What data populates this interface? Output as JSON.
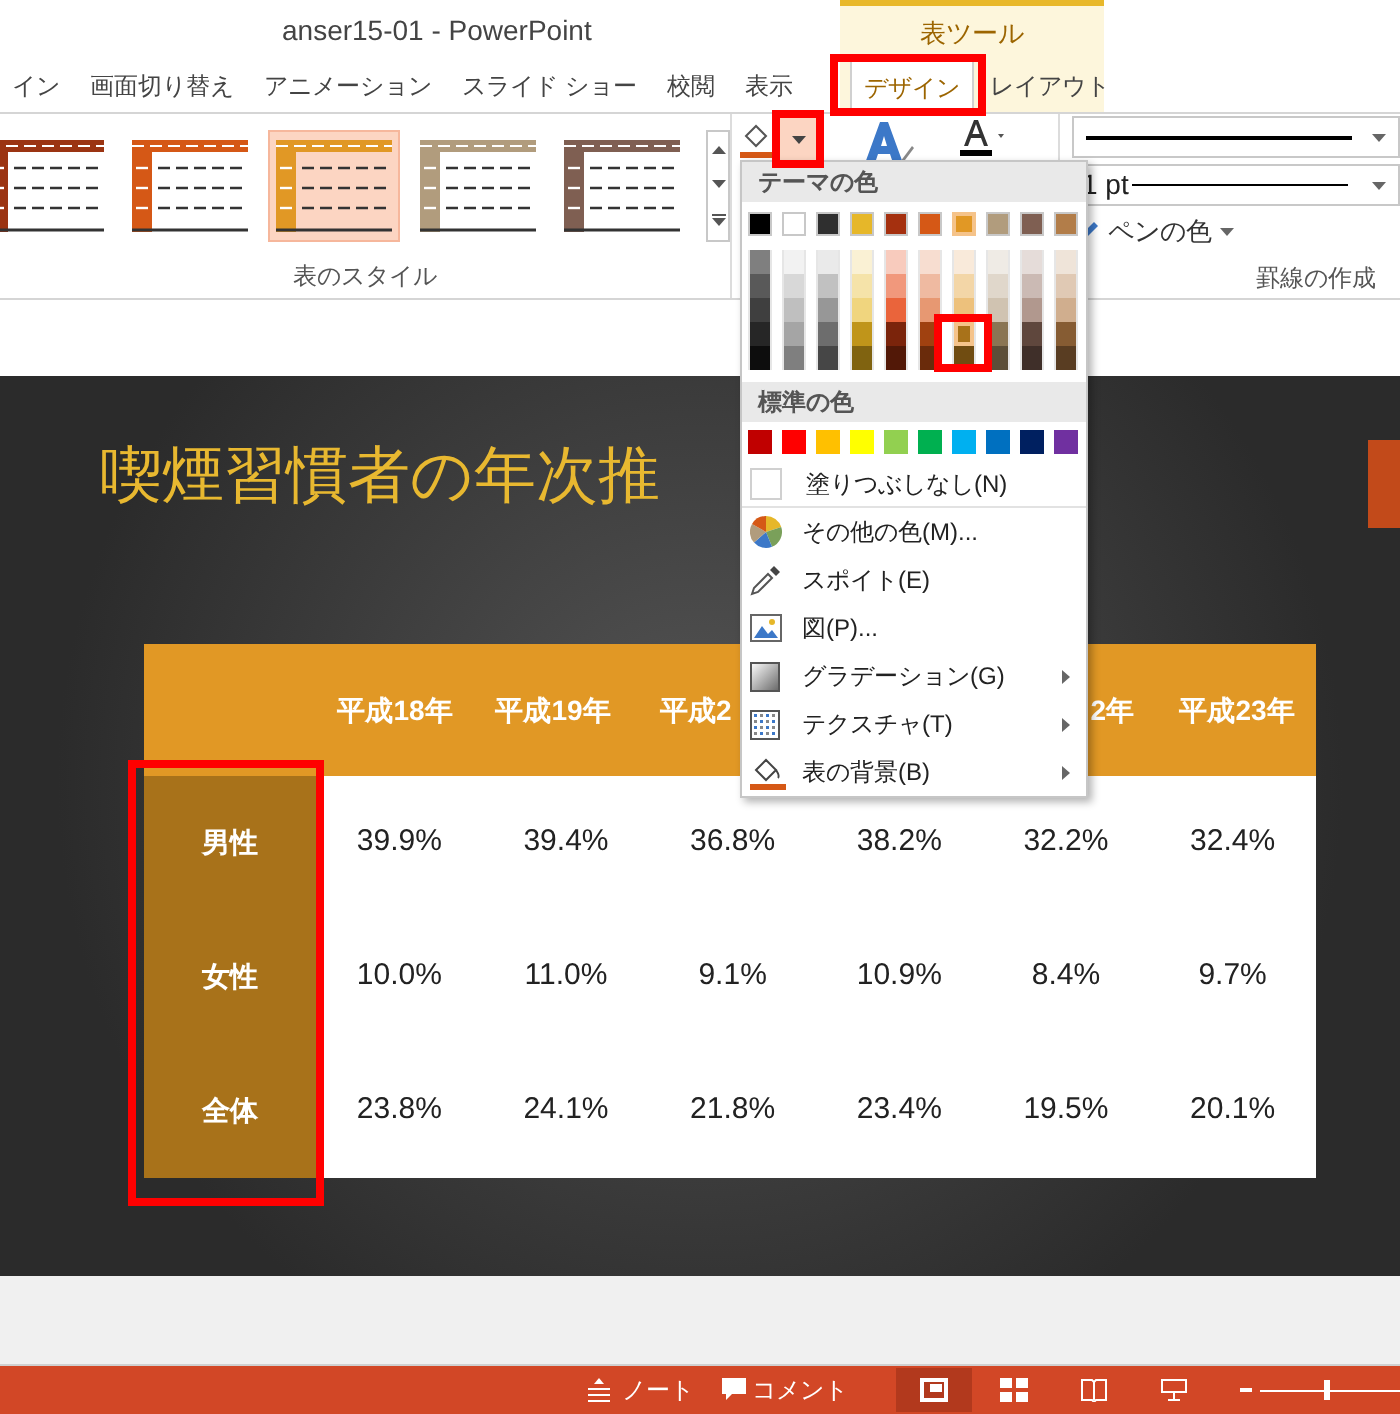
{
  "window": {
    "title": "anser15-01 - PowerPoint"
  },
  "tabs": [
    {
      "label": "イン",
      "selected": false
    },
    {
      "label": "画面切り替え",
      "selected": false
    },
    {
      "label": "アニメーション",
      "selected": false
    },
    {
      "label": "スライド ショー",
      "selected": false
    },
    {
      "label": "校閲",
      "selected": false
    },
    {
      "label": "表示",
      "selected": false
    }
  ],
  "context_tabs": {
    "label": "表ツール",
    "tabs": [
      {
        "label": "デザイン",
        "selected": true
      },
      {
        "label": "レイアウト",
        "selected": false
      }
    ]
  },
  "ribbon": {
    "table_styles": [
      {
        "color": "#9b3412",
        "selected": false
      },
      {
        "color": "#d55816",
        "selected": false
      },
      {
        "color": "#e19825",
        "selected": true
      },
      {
        "color": "#b19c7d",
        "selected": false
      },
      {
        "color": "#7f5f52",
        "selected": false
      }
    ],
    "styles_group_label": "表のスタイル",
    "pen_weight": "1 pt",
    "pen_color": "ペンの色",
    "borders_group_label": "罫線の作成"
  },
  "shading_menu": {
    "theme_heading": "テーマの色",
    "theme_colors": [
      [
        {
          "color": "#000000",
          "selected": false
        },
        {
          "color": "#ffffff",
          "selected": false
        },
        {
          "color": "#2f2f2f",
          "selected": false
        },
        {
          "color": "#e6b729",
          "selected": false
        },
        {
          "color": "#a5300f",
          "selected": false
        },
        {
          "color": "#d55816",
          "selected": false
        },
        {
          "color": "#e19825",
          "selected": true
        },
        {
          "color": "#b19c7d",
          "selected": false
        },
        {
          "color": "#7f5f52",
          "selected": false
        },
        {
          "color": "#b27d49",
          "selected": false
        }
      ],
      [
        {
          "color": "#7f7f7f",
          "selected": false
        },
        {
          "color": "#f2f2f2",
          "selected": false
        },
        {
          "color": "#eaeaea",
          "selected": false
        },
        {
          "color": "#faf1d4",
          "selected": false
        },
        {
          "color": "#f8cbbd",
          "selected": false
        },
        {
          "color": "#f7ddd0",
          "selected": false
        },
        {
          "color": "#f9eada",
          "selected": false
        },
        {
          "color": "#efebe5",
          "selected": false
        },
        {
          "color": "#e5dcd9",
          "selected": false
        },
        {
          "color": "#efe4d9",
          "selected": false
        }
      ],
      [
        {
          "color": "#595959",
          "selected": false
        },
        {
          "color": "#d8d8d8",
          "selected": false
        },
        {
          "color": "#c1c1c1",
          "selected": false
        },
        {
          "color": "#f5e3a9",
          "selected": false
        },
        {
          "color": "#f1987c",
          "selected": false
        },
        {
          "color": "#efbaa1",
          "selected": false
        },
        {
          "color": "#f3d6a7",
          "selected": false
        },
        {
          "color": "#e0d7cb",
          "selected": false
        },
        {
          "color": "#cbbab4",
          "selected": false
        },
        {
          "color": "#e0c9b4",
          "selected": false
        }
      ],
      [
        {
          "color": "#3f3f3f",
          "selected": false
        },
        {
          "color": "#bfbfbf",
          "selected": false
        },
        {
          "color": "#979797",
          "selected": false
        },
        {
          "color": "#f0d57e",
          "selected": false
        },
        {
          "color": "#ea643b",
          "selected": false
        },
        {
          "color": "#e79872",
          "selected": false
        },
        {
          "color": "#edc17c",
          "selected": false
        },
        {
          "color": "#d0c3b1",
          "selected": false
        },
        {
          "color": "#b1988e",
          "selected": false
        },
        {
          "color": "#d0ae8e",
          "selected": false
        }
      ],
      [
        {
          "color": "#262626",
          "selected": false
        },
        {
          "color": "#a5a5a5",
          "selected": false
        },
        {
          "color": "#6d6d6d",
          "selected": false
        },
        {
          "color": "#c0951a",
          "selected": false
        },
        {
          "color": "#7b240b",
          "selected": false
        },
        {
          "color": "#a04110",
          "selected": false
        },
        {
          "color": "#a8721a",
          "selected": true
        },
        {
          "color": "#8a7553",
          "selected": false
        },
        {
          "color": "#5f473d",
          "selected": false
        },
        {
          "color": "#865c33",
          "selected": false
        }
      ],
      [
        {
          "color": "#0d0d0d",
          "selected": false
        },
        {
          "color": "#7f7f7f",
          "selected": false
        },
        {
          "color": "#464646",
          "selected": false
        },
        {
          "color": "#806310",
          "selected": false
        },
        {
          "color": "#521807",
          "selected": false
        },
        {
          "color": "#6a2b0b",
          "selected": false
        },
        {
          "color": "#704c11",
          "selected": false
        },
        {
          "color": "#5c4e38",
          "selected": false
        },
        {
          "color": "#3f2f29",
          "selected": false
        },
        {
          "color": "#593d22",
          "selected": false
        }
      ]
    ],
    "standard_heading": "標準の色",
    "standard_colors": [
      {
        "color": "#c00000"
      },
      {
        "color": "#ff0000"
      },
      {
        "color": "#ffc000"
      },
      {
        "color": "#ffff00"
      },
      {
        "color": "#92d050"
      },
      {
        "color": "#00b050"
      },
      {
        "color": "#00b0f0"
      },
      {
        "color": "#0070c0"
      },
      {
        "color": "#002060"
      },
      {
        "color": "#7030a0"
      }
    ],
    "no_fill": "塗りつぶしなし(N)",
    "items": [
      {
        "kind": "more",
        "label": "その他の色(M)...",
        "submenu": false
      },
      {
        "kind": "eyedropper",
        "label": "スポイト(E)",
        "submenu": false
      },
      {
        "kind": "picture",
        "label": "図(P)...",
        "submenu": false
      },
      {
        "kind": "gradient",
        "label": "グラデーション(G)",
        "submenu": true
      },
      {
        "kind": "texture",
        "label": "テクスチャ(T)",
        "submenu": true
      },
      {
        "kind": "background",
        "label": "表の背景(B)",
        "submenu": true
      }
    ]
  },
  "slide": {
    "title": "喫煙習慣者の年次推",
    "table": {
      "columns": [
        "平成18年",
        "平成19年",
        "平成2",
        null,
        "2年",
        "平成23年"
      ],
      "rows": [
        {
          "label": "男性",
          "values": [
            "39.9%",
            "39.4%",
            "36.8%",
            "38.2%",
            "32.2%",
            "32.4%"
          ]
        },
        {
          "label": "女性",
          "values": [
            "10.0%",
            "11.0%",
            "9.1%",
            "10.9%",
            "8.4%",
            "9.7%"
          ]
        },
        {
          "label": "全体",
          "values": [
            "23.8%",
            "24.1%",
            "21.8%",
            "23.4%",
            "19.5%",
            "20.1%"
          ]
        }
      ]
    }
  },
  "status_bar": {
    "notes": "ノート",
    "comments": "コメント",
    "views": [
      {
        "kind": "normal",
        "selected": true
      },
      {
        "kind": "sorter",
        "selected": false
      },
      {
        "kind": "reading",
        "selected": false
      },
      {
        "kind": "slideshow",
        "selected": false
      }
    ],
    "zoom": {
      "level": 0.47
    }
  }
}
